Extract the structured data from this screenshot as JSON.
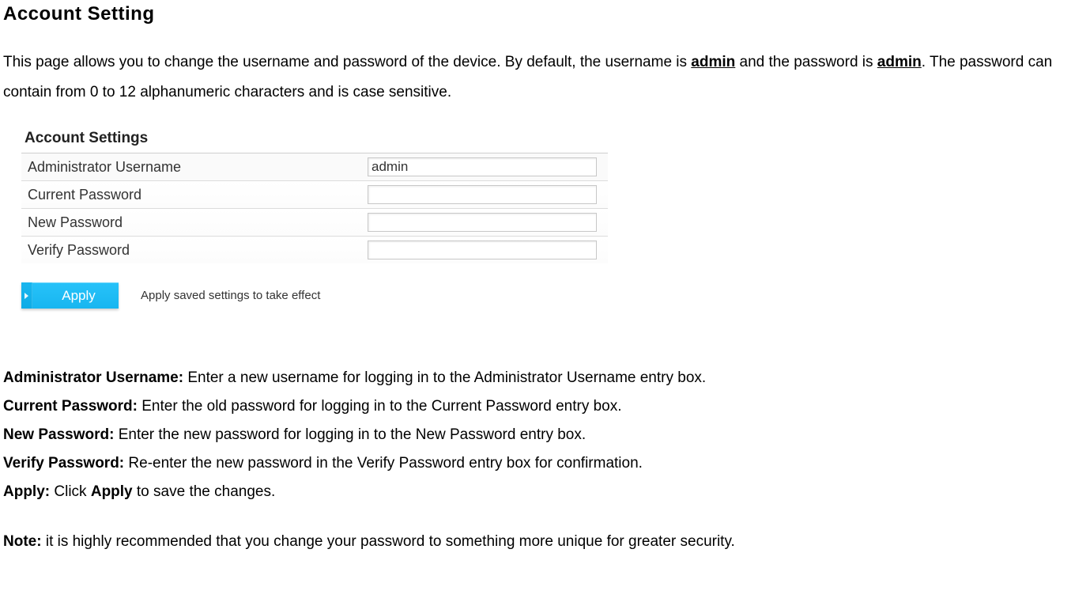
{
  "heading": "Account Setting",
  "intro": {
    "part1": "This page allows you to change the username and password of the device. By default, the username is ",
    "bold1": "admin",
    "part2": " and the password is ",
    "bold2": "admin",
    "part3": ". The password can contain from 0 to 12 alphanumeric characters and is case sensitive."
  },
  "panel": {
    "title": "Account Settings",
    "rows": [
      {
        "label": "Administrator Username",
        "value": "admin",
        "type": "text"
      },
      {
        "label": "Current Password",
        "value": "",
        "type": "password"
      },
      {
        "label": "New Password",
        "value": "",
        "type": "password"
      },
      {
        "label": "Verify Password",
        "value": "",
        "type": "password"
      }
    ],
    "apply_label": "Apply",
    "apply_desc": "Apply saved settings to take effect"
  },
  "defs": {
    "admin_user": {
      "term": "Administrator Username:",
      "desc": " Enter a new username for logging in to the Administrator Username entry box."
    },
    "current_pw": {
      "term": "Current Password:",
      "desc": " Enter the old password for logging in to the Current Password entry box."
    },
    "new_pw": {
      "term": "New Password:",
      "desc": " Enter the new password for logging in to the New Password entry box."
    },
    "verify_pw": {
      "term": "Verify Password:",
      "desc": " Re-enter the new password in the Verify Password entry box for confirmation."
    },
    "apply": {
      "term": "Apply:",
      "desc_pre": " Click ",
      "desc_bold": "Apply",
      "desc_post": " to save the changes."
    }
  },
  "note": {
    "term": "Note:",
    "desc": " it is highly recommended that you change your password to something more unique for greater security."
  }
}
